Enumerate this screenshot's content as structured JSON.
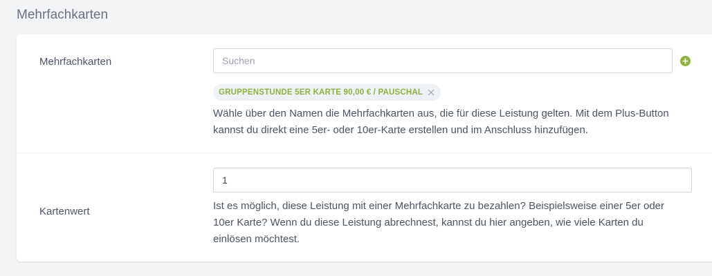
{
  "section": {
    "title": "Mehrfachkarten"
  },
  "mehrfachkarten": {
    "label": "Mehrfachkarten",
    "search_placeholder": "Suchen",
    "search_value": "",
    "add_icon": "plus-circle-icon",
    "selected_tags": [
      {
        "label": "GRUPPENSTUNDE 5ER KARTE 90,00 € / PAUSCHAL",
        "remove_icon": "close-icon"
      }
    ],
    "help_text": "Wähle über den Namen die Mehrfachkarten aus, die für diese Leistung gelten. Mit dem Plus-Button kannst du direkt eine 5er- oder 10er-Karte erstellen und im Anschluss hinzufügen."
  },
  "kartenwert": {
    "label": "Kartenwert",
    "value": "1",
    "help_text": "Ist es möglich, diese Leistung mit einer Mehrfachkarte zu bezahlen? Beispielsweise einer 5er oder 10er Karte? Wenn du diese Leistung abrechnest, kannst du hier angeben, wie viele Karten du einlösen möchtest."
  },
  "colors": {
    "accent": "#8fb339",
    "tag_background": "#eef2f6",
    "page_background": "#f3f4f6"
  }
}
